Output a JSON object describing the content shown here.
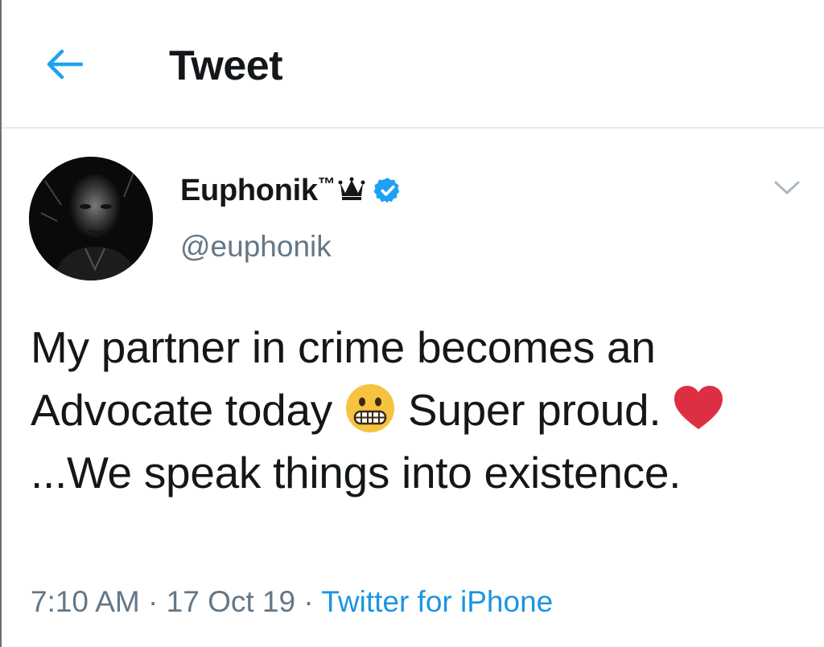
{
  "header": {
    "back_icon": "arrow-left-icon",
    "title": "Tweet",
    "accent_color": "#1da1f2"
  },
  "tweet": {
    "display_name": "Euphonik",
    "name_suffix": "™",
    "crown_icon": "crown-icon",
    "verified_icon": "verified-badge-icon",
    "handle": "@euphonik",
    "caret_icon": "chevron-down-icon",
    "text_part1": "My partner in crime becomes an Advocate today ",
    "emoji1": "grimacing-face-emoji",
    "text_part2": " Super proud. ",
    "emoji2": "red-heart-emoji",
    "text_part3": "...We speak things into existence.",
    "time": "7:10 AM",
    "sep1": " · ",
    "date": "17 Oct 19",
    "sep2": " · ",
    "source": "Twitter for iPhone"
  }
}
